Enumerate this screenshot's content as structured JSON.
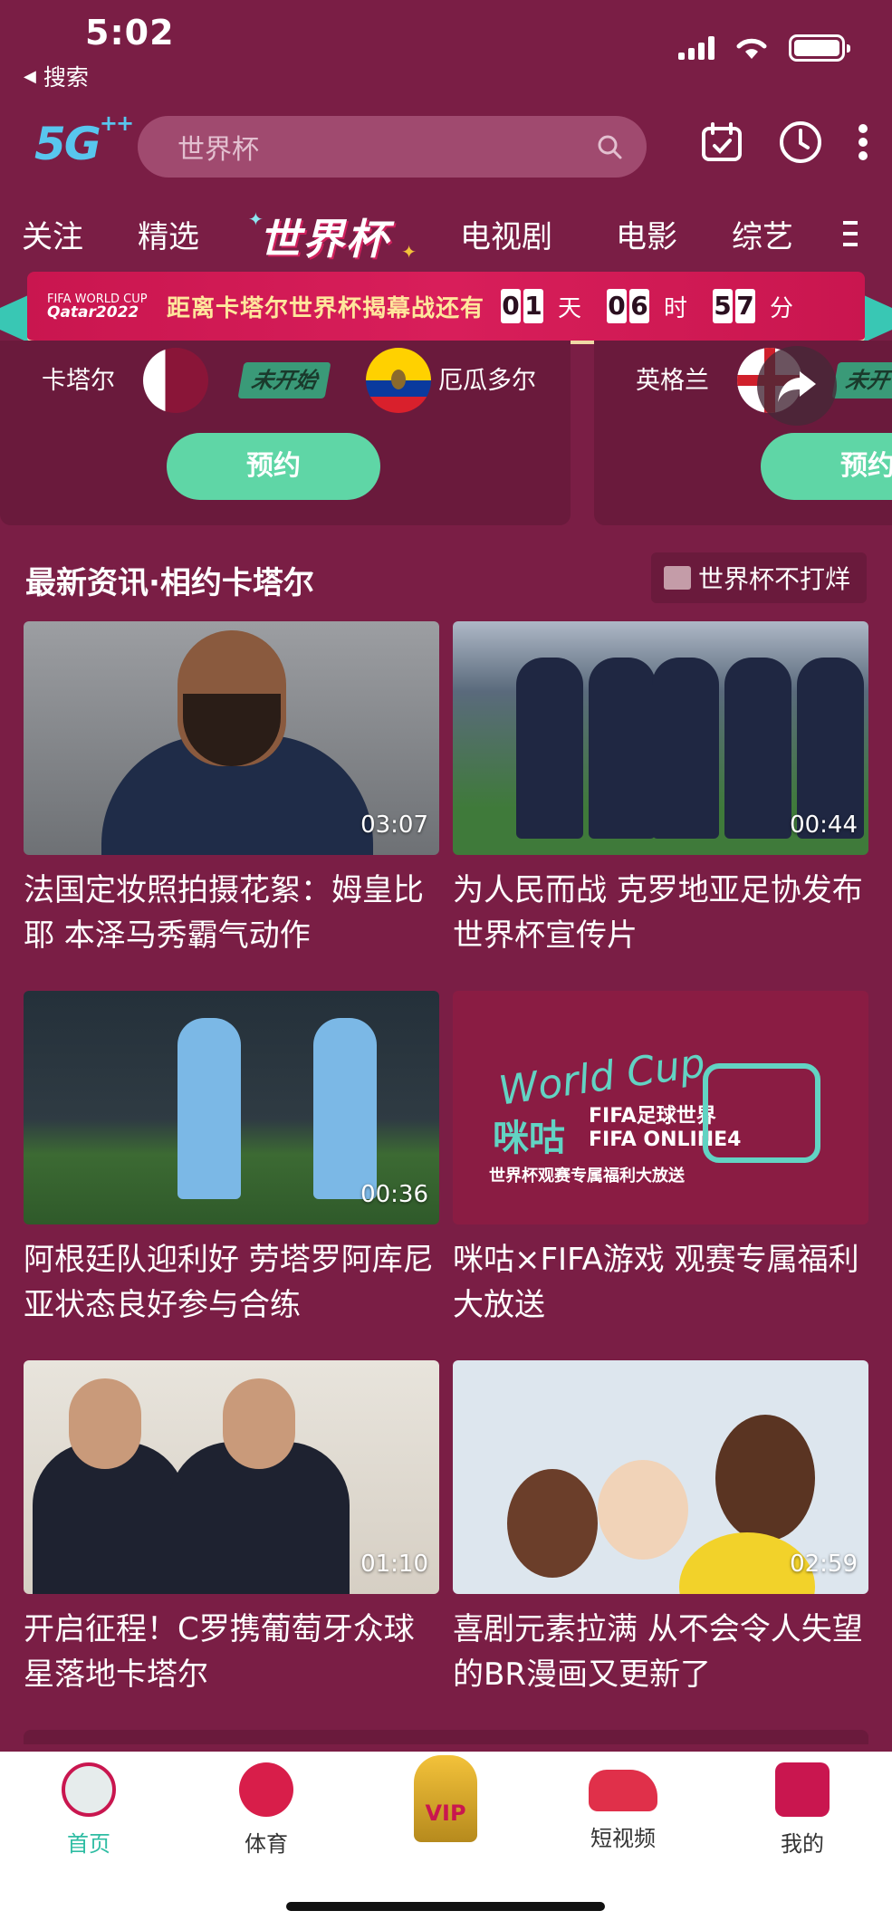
{
  "status_bar": {
    "time": "5:02",
    "back_label": "搜索"
  },
  "header": {
    "logo": "5G",
    "logo_sup": "++",
    "search_placeholder": "世界杯"
  },
  "nav": {
    "tabs": [
      "关注",
      "精选",
      "世界杯",
      "电视剧",
      "电影",
      "综艺"
    ],
    "active": "世界杯"
  },
  "countdown": {
    "logo_line1": "FIFA WORLD CUP",
    "logo_line2": "Qatar2022",
    "text": "距离卡塔尔世界杯揭幕战还有",
    "days": "01",
    "day_unit": "天",
    "hours": "06",
    "hour_unit": "时",
    "minutes": "57",
    "minute_unit": "分"
  },
  "matches": [
    {
      "home": "卡塔尔",
      "away": "厄瓜多尔",
      "status": "未开始",
      "button": "预约"
    },
    {
      "home": "英格兰",
      "away": "",
      "status": "未开",
      "button": "预约"
    }
  ],
  "section": {
    "title": "最新资讯·相约卡塔尔",
    "tag": "世界杯不打烊"
  },
  "videos": [
    {
      "duration": "03:07",
      "title": "法国定妆照拍摄花絮：姆皇比耶 本泽马秀霸气动作"
    },
    {
      "duration": "00:44",
      "title": "为人民而战 克罗地亚足协发布世界杯宣传片"
    },
    {
      "duration": "00:36",
      "title": "阿根廷队迎利好 劳塔罗阿库尼亚状态良好参与合练"
    },
    {
      "duration": "",
      "title": "咪咕×FIFA游戏 观赛专属福利大放送"
    },
    {
      "duration": "01:10",
      "title": "开启征程！C罗携葡萄牙众球星落地卡塔尔"
    },
    {
      "duration": "02:59",
      "title": "喜剧元素拉满 从不会令人失望的BR漫画又更新了"
    }
  ],
  "promo": {
    "script": "World Cup",
    "brand": "咪咕",
    "fifa_line1": "FIFA足球世界",
    "fifa_line2": "FIFA ONLINE4",
    "subtitle": "世界杯观赛专属福利大放送"
  },
  "tabbar": {
    "items": [
      {
        "label": "首页",
        "icon": "home-mascot-icon"
      },
      {
        "label": "体育",
        "icon": "football-icon"
      },
      {
        "label": "VIP",
        "icon": "trophy-vip-icon"
      },
      {
        "label": "短视频",
        "icon": "boot-icon"
      },
      {
        "label": "我的",
        "icon": "jersey-icon"
      }
    ]
  },
  "colors": {
    "background": "#7a1e45",
    "accent_green": "#5fd6a6",
    "active_tab": "#2fbda3"
  }
}
